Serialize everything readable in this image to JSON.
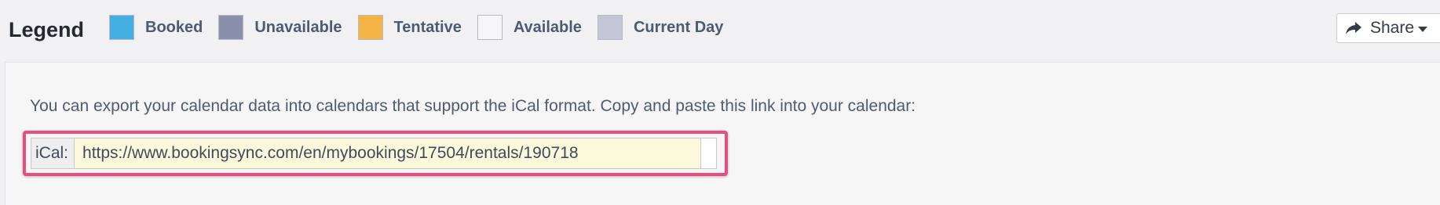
{
  "legend": {
    "title": "Legend",
    "items": [
      {
        "label": "Booked",
        "color": "#45aee3"
      },
      {
        "label": "Unavailable",
        "color": "#8a90ac"
      },
      {
        "label": "Tentative",
        "color": "#f4b345"
      },
      {
        "label": "Available",
        "color": "#f7f7fa"
      },
      {
        "label": "Current Day",
        "color": "#c4c6d8"
      }
    ]
  },
  "share": {
    "label": "Share",
    "icon": "share-arrow-icon"
  },
  "export": {
    "description": "You can export your calendar data into calendars that support the iCal format. Copy and paste this link into your calendar:",
    "ical_label": "iCal:",
    "ical_url": "https://www.bookingsync.com/en/mybookings/17504/rentals/190718",
    "highlight_color": "#ea4c80",
    "input_bg": "#fcf8dc"
  }
}
